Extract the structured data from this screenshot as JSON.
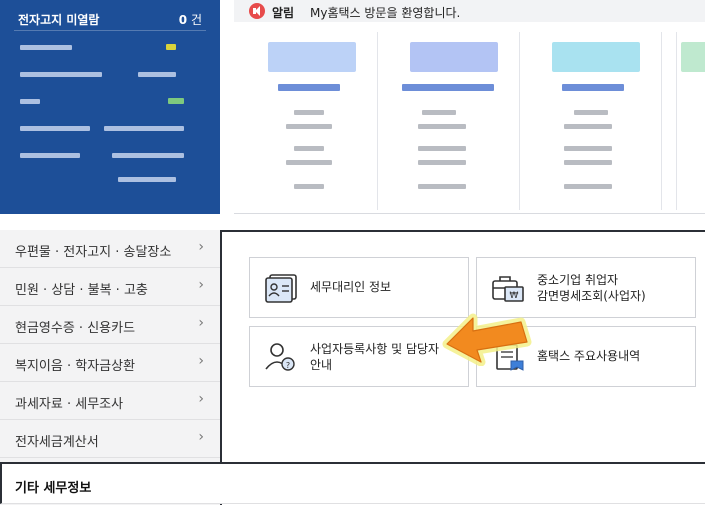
{
  "notice": {
    "tag": "알림",
    "message": "My홈택스 방문을 환영합니다."
  },
  "summary_panel": {
    "first_row": {
      "label": "전자고지 미열람",
      "count": "0",
      "unit": "건"
    }
  },
  "menu": {
    "items": [
      {
        "label": "우편물 · 전자고지 · 송달장소",
        "chevron": "›"
      },
      {
        "label": "민원 · 상담 · 불복 · 고충",
        "chevron": "›"
      },
      {
        "label": "현금영수증 · 신용카드",
        "chevron": "›"
      },
      {
        "label": "복지이음 · 학자금상환",
        "chevron": "›"
      },
      {
        "label": "과세자료 · 세무조사",
        "chevron": "›"
      },
      {
        "label": "전자세금계산서",
        "chevron": "›"
      }
    ],
    "active_label": "기타 세무정보"
  },
  "tiles": [
    {
      "line1": "세무대리인 정보",
      "line2": "",
      "icon": "id-card-icon"
    },
    {
      "line1": "중소기업 취업자",
      "line2": "감면명세조회(사업자)",
      "icon": "briefcase-document-icon"
    },
    {
      "line1": "사업자등록사항 및 담당자",
      "line2": "안내",
      "icon": "person-question-icon"
    },
    {
      "line1": "홈택스 주요사용내역",
      "line2": "",
      "icon": "document-ribbon-icon"
    }
  ],
  "colors": {
    "panel_blue": "#1d4f98",
    "accent_arrow": "#f28a1f",
    "arrow_glow": "#f3f08a"
  }
}
